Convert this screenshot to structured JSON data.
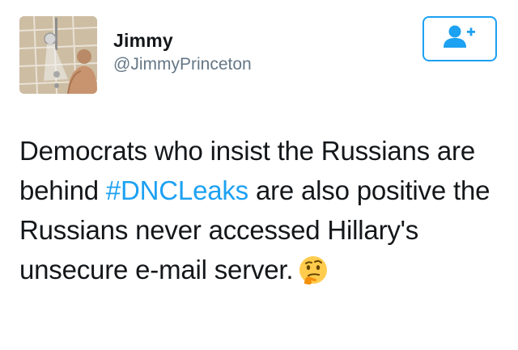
{
  "tweet": {
    "author": {
      "name": "Jimmy",
      "handle": "@JimmyPrinceton"
    },
    "follow_icon": "follow-user-plus-icon",
    "text": {
      "part1": "Democrats who insist the Russians are behind ",
      "hashtag": "#DNCLeaks",
      "part2": " are also positive the Russians never accessed Hillary's unsecure e-mail server.",
      "emoji": "thinking-face"
    },
    "colors": {
      "accent": "#1da1f2",
      "text": "#14171a",
      "secondary": "#657786"
    }
  }
}
